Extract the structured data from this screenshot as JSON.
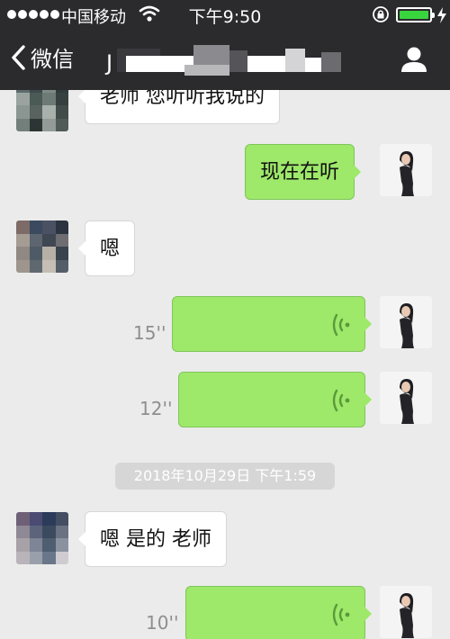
{
  "status_bar": {
    "carrier": "中国移动",
    "time": "下午9:50",
    "battery_level": 1.0
  },
  "nav": {
    "back_label": "微信",
    "title": "J"
  },
  "messages": [
    {
      "side": "in",
      "kind": "text",
      "text": "老师 您听听我说的"
    },
    {
      "side": "out",
      "kind": "text",
      "text": "现在在听"
    },
    {
      "side": "in",
      "kind": "text",
      "text": "嗯"
    },
    {
      "side": "out",
      "kind": "voice",
      "duration": "15''"
    },
    {
      "side": "out",
      "kind": "voice",
      "duration": "12''"
    },
    {
      "side": "in",
      "kind": "text",
      "text": "嗯 是的 老师"
    },
    {
      "side": "out",
      "kind": "voice",
      "duration": "10''"
    }
  ],
  "timestamp": "2018年10月29日 下午1:59",
  "colors": {
    "nav_background": "#2b2b2e",
    "chat_background": "#ebebeb",
    "bubble_out": "#9ee86a",
    "bubble_in": "#ffffff",
    "battery": "#39d53f"
  },
  "icons": [
    "signal-dots-icon",
    "wifi-icon",
    "rotation-lock-icon",
    "battery-icon",
    "charging-icon",
    "back-chevron-icon",
    "profile-icon",
    "voice-wave-icon"
  ]
}
